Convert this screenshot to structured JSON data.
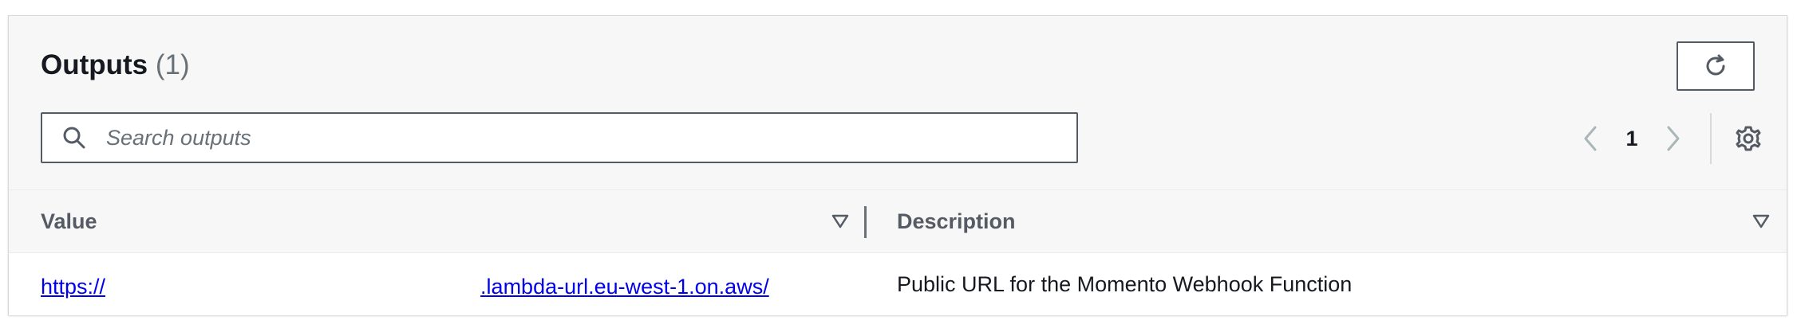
{
  "outputs": {
    "title": "Outputs",
    "count": "(1)",
    "refresh_icon": "refresh-icon",
    "search": {
      "placeholder": "Search outputs",
      "value": "",
      "icon": "search-icon"
    },
    "pagination": {
      "current_page": "1",
      "prev_icon": "chevron-left-icon",
      "next_icon": "chevron-right-icon"
    },
    "settings_icon": "gear-icon",
    "columns": [
      {
        "label": "Value",
        "sort_icon": "sort-down-icon"
      },
      {
        "label": "Description",
        "sort_icon": "sort-down-icon"
      }
    ],
    "rows": [
      {
        "value_prefix": "https://",
        "value_suffix": ".lambda-url.eu-west-1.on.aws/",
        "description": "Public URL for the Momento Webhook Function"
      }
    ]
  },
  "colors": {
    "link": "#0000ee",
    "header_bg": "#f7f7f7",
    "border": "#545b64",
    "text_primary": "#16191f",
    "text_secondary": "#545b64",
    "muted": "#687078"
  }
}
